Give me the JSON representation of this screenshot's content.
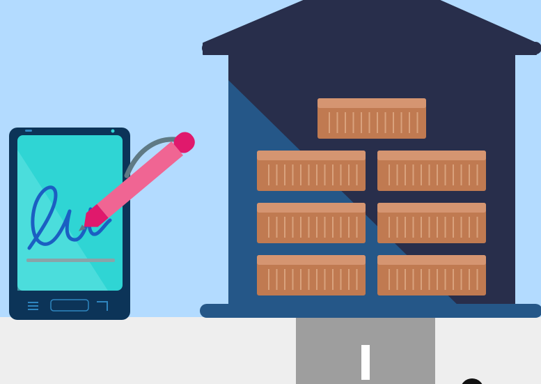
{
  "scene": {
    "description_label": "",
    "colors": {
      "sky": "#b3dbff",
      "ground": "#eeeeee",
      "road": "#9e9e9e",
      "road_marking": "#ffffff",
      "warehouse_dark": "#282e4b",
      "warehouse_light": "#255788",
      "crate_body": "#c07a51",
      "crate_top": "#d59571",
      "crate_slat": "#d9a27d",
      "phone_case": "#0c3458",
      "phone_screen": "#2fd5d4",
      "phone_screen_light": "#62e3e1",
      "signature": "#1b5fc2",
      "signature_line": "#8aa3a8",
      "pen_body": "#f06593",
      "pen_cap": "#e0196c",
      "pen_clip": "#5f7a85",
      "phone_buttons": "#2f86c0"
    },
    "icons": {
      "warehouse": "warehouse-icon",
      "crate": "shipping-crate-icon",
      "phone": "smartphone-icon",
      "pen": "stylus-pen-icon",
      "signature": "signature-icon",
      "menu": "menu-icon",
      "home": "home-button-icon",
      "back": "back-icon"
    }
  }
}
